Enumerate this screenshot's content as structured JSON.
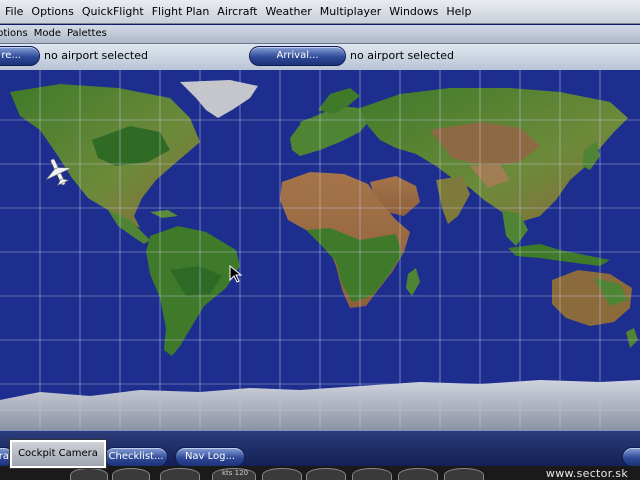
{
  "menubar": {
    "items": [
      "File",
      "Options",
      "QuickFlight",
      "Flight Plan",
      "Aircraft",
      "Weather",
      "Multiplayer",
      "Windows",
      "Help"
    ]
  },
  "submenu": {
    "items": [
      "ptions",
      "Mode",
      "Palettes"
    ]
  },
  "route": {
    "departure_label": "re...",
    "departure_text": "no airport selected",
    "arrival_label": "Arrival...",
    "arrival_text": "no airport selected"
  },
  "bottom": {
    "left_stub": "ra",
    "cockpit_camera": "Cockpit Camera",
    "checklist": "Checklist...",
    "navlog": "Nav Log..."
  },
  "instrument_readout": "kts 120",
  "watermark": "www.sector.sk",
  "icons": {
    "aircraft": "aircraft-icon",
    "cursor": "cursor-icon"
  },
  "colors": {
    "ocean": "#1d2e8f",
    "grid": "#c8c8dc",
    "button_blue": "#2f4a98"
  }
}
